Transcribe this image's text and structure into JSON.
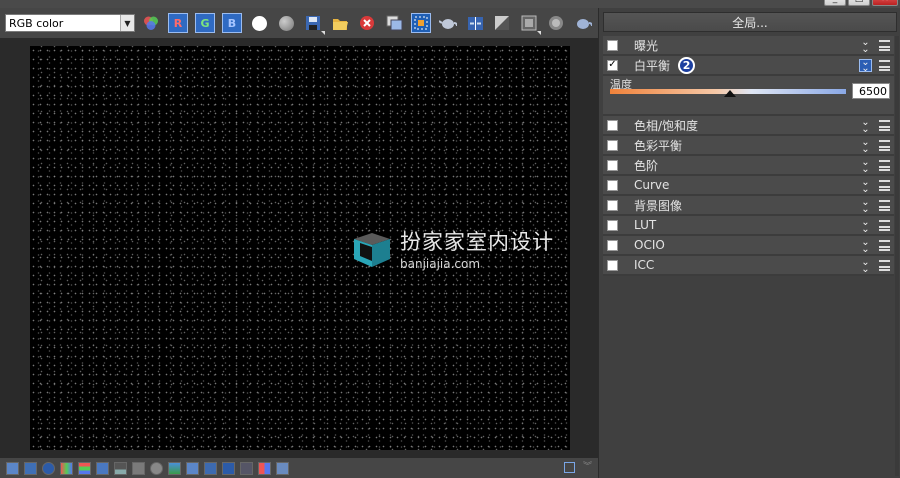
{
  "toolbar": {
    "channel": "RGB color",
    "r_label": "R",
    "g_label": "G",
    "b_label": "B"
  },
  "viewport": {
    "watermark_cn": "扮家家室内设计",
    "watermark_en": "banjiajia.com"
  },
  "panel": {
    "global_label": "全局...",
    "white_balance": {
      "label": "白平衡",
      "badge": "2",
      "temperature_label": "温度",
      "temperature_value": "6500",
      "slider_fraction": 0.51
    },
    "corrections": [
      {
        "label": "曝光",
        "checked": false
      },
      {
        "label": "色相/饱和度",
        "checked": false
      },
      {
        "label": "色彩平衡",
        "checked": false
      },
      {
        "label": "色阶",
        "checked": false
      },
      {
        "label": "Curve",
        "checked": false
      },
      {
        "label": "背景图像",
        "checked": false
      },
      {
        "label": "LUT",
        "checked": false
      },
      {
        "label": "OCIO",
        "checked": false
      },
      {
        "label": "ICC",
        "checked": false
      }
    ]
  },
  "icons": {
    "toolbar": [
      "color-mixer-icon",
      "r-channel-icon",
      "g-channel-icon",
      "b-channel-icon",
      "white-circle-icon",
      "gray-circle-icon",
      "save-icon",
      "open-folder-icon",
      "clear-icon",
      "copy-icon",
      "region-icon",
      "teapot-icon",
      "compare-icon",
      "corrections-icon",
      "lens-icon",
      "stereo-icon",
      "teapot-small-icon"
    ]
  }
}
